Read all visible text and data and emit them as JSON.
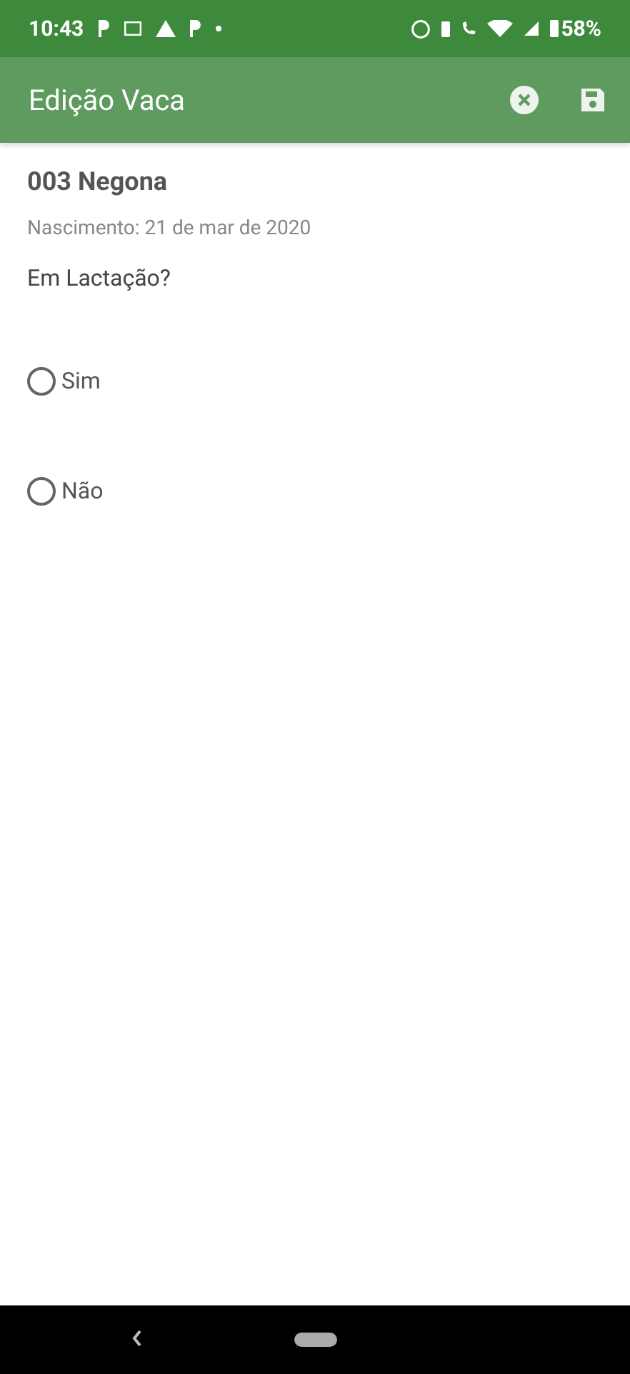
{
  "status_bar": {
    "time": "10:43",
    "battery": "58%"
  },
  "app_bar": {
    "title": "Edição Vaca"
  },
  "animal": {
    "name": "003 Negona",
    "birth": "Nascimento: 21 de mar de 2020"
  },
  "question": "Em Lactação?",
  "options": [
    {
      "label": "Sim",
      "selected": false
    },
    {
      "label": "Não",
      "selected": false
    }
  ]
}
